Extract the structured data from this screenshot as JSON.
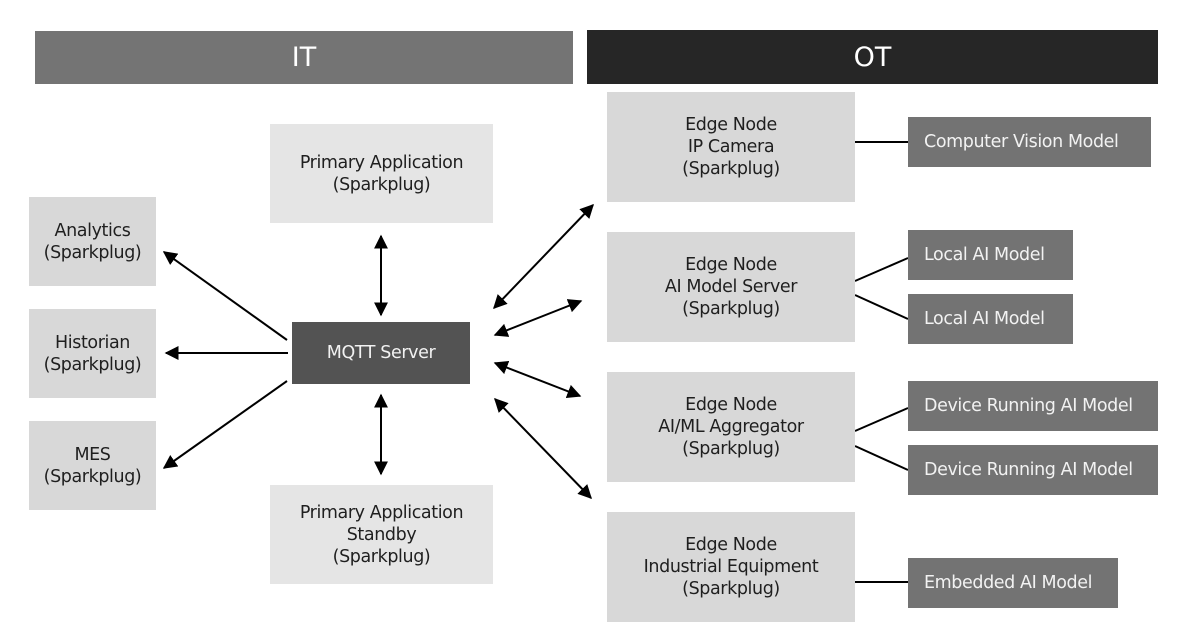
{
  "headers": {
    "it": "IT",
    "ot": "OT"
  },
  "colors": {
    "it_header": "#747474",
    "ot_header": "#262626",
    "node_light": "#d8d8d8",
    "app_light": "#e5e5e5",
    "mqtt_dark": "#535353",
    "model_box": "#737373"
  },
  "it": {
    "consumers": [
      {
        "label": "Analytics\n(Sparkplug)"
      },
      {
        "label": "Historian\n(Sparkplug)"
      },
      {
        "label": "MES\n(Sparkplug)"
      }
    ],
    "primary_app": {
      "label": "Primary Application\n(Sparkplug)"
    },
    "primary_app_standby": {
      "label": "Primary Application\nStandby\n(Sparkplug)"
    },
    "mqtt_server": {
      "label": "MQTT Server"
    }
  },
  "ot": {
    "edge_nodes": [
      {
        "label": "Edge Node\nIP Camera\n(Sparkplug)",
        "models": [
          "Computer Vision Model"
        ]
      },
      {
        "label": "Edge Node\nAI Model Server\n(Sparkplug)",
        "models": [
          "Local AI Model",
          "Local AI Model"
        ]
      },
      {
        "label": "Edge Node\nAI/ML Aggregator\n(Sparkplug)",
        "models": [
          "Device Running AI Model",
          "Device Running AI Model"
        ]
      },
      {
        "label": "Edge Node\nIndustrial Equipment\n(Sparkplug)",
        "models": [
          "Embedded AI Model"
        ]
      }
    ]
  },
  "connections": [
    {
      "from": "mqtt-server",
      "to": "analytics",
      "direction": "one-way"
    },
    {
      "from": "mqtt-server",
      "to": "historian",
      "direction": "one-way"
    },
    {
      "from": "mqtt-server",
      "to": "mes",
      "direction": "one-way"
    },
    {
      "from": "mqtt-server",
      "to": "primary-application",
      "direction": "bidirectional"
    },
    {
      "from": "mqtt-server",
      "to": "primary-application-standby",
      "direction": "bidirectional"
    },
    {
      "from": "mqtt-server",
      "to": "edge-node-ip-camera",
      "direction": "bidirectional"
    },
    {
      "from": "mqtt-server",
      "to": "edge-node-ai-model-server",
      "direction": "bidirectional"
    },
    {
      "from": "mqtt-server",
      "to": "edge-node-ai-ml-aggregator",
      "direction": "bidirectional"
    },
    {
      "from": "mqtt-server",
      "to": "edge-node-industrial-equipment",
      "direction": "bidirectional"
    }
  ]
}
